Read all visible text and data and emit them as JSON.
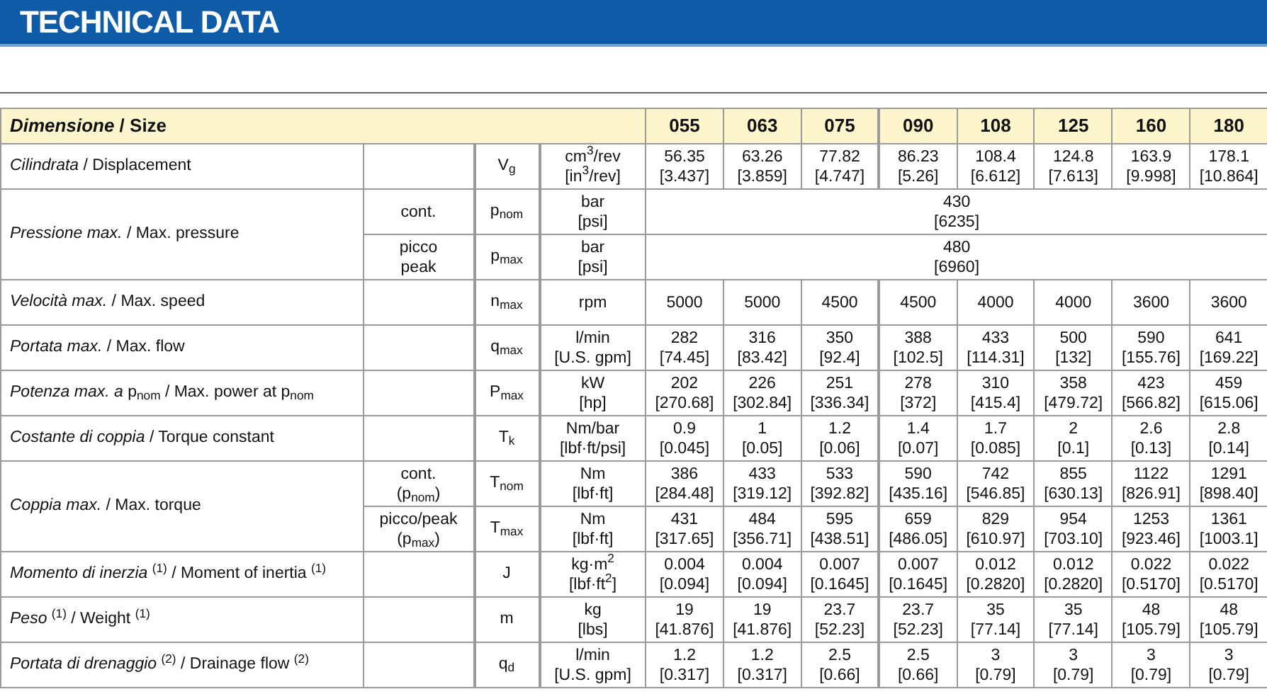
{
  "title": "TECHNICAL DATA",
  "table": {
    "header_label": "*Dimensione* / Size",
    "sizes": [
      "055",
      "063",
      "075",
      "090",
      "108",
      "125",
      "160",
      "180"
    ],
    "rows": [
      {
        "label": "*Cilindrata* / Displacement",
        "subrows": [
          {
            "symbol": "V$_{g}$",
            "unit": [
              "cm$^{3}$/rev",
              "[in$^{3}$/rev]"
            ],
            "values": [
              [
                "56.35",
                "[3.437]"
              ],
              [
                "63.26",
                "[3.859]"
              ],
              [
                "77.82",
                "[4.747]"
              ],
              [
                "86.23",
                "[5.26]"
              ],
              [
                "108.4",
                "[6.612]"
              ],
              [
                "124.8",
                "[7.613]"
              ],
              [
                "163.9",
                "[9.998]"
              ],
              [
                "178.1",
                "[10.864]"
              ]
            ]
          }
        ]
      },
      {
        "label": "*Pressione max.* / Max. pressure",
        "subrows": [
          {
            "condition": [
              "cont."
            ],
            "symbol": "p$_{nom}$",
            "unit": [
              "bar",
              "[psi]"
            ],
            "merged_value": [
              "430",
              "[6235]"
            ]
          },
          {
            "condition": [
              "picco",
              "peak"
            ],
            "symbol": "p$_{max}$",
            "unit": [
              "bar",
              "[psi]"
            ],
            "merged_value": [
              "480",
              "[6960]"
            ]
          }
        ]
      },
      {
        "label": "*Velocità max.* / Max. speed",
        "subrows": [
          {
            "symbol": "n$_{max}$",
            "unit": [
              "rpm"
            ],
            "values": [
              [
                "5000"
              ],
              [
                "5000"
              ],
              [
                "4500"
              ],
              [
                "4500"
              ],
              [
                "4000"
              ],
              [
                "4000"
              ],
              [
                "3600"
              ],
              [
                "3600"
              ]
            ]
          }
        ]
      },
      {
        "label": "*Portata max.* / Max. flow",
        "subrows": [
          {
            "symbol": "q$_{max}$",
            "unit": [
              "l/min",
              "[U.S. gpm]"
            ],
            "values": [
              [
                "282",
                "[74.45]"
              ],
              [
                "316",
                "[83.42]"
              ],
              [
                "350",
                "[92.4]"
              ],
              [
                "388",
                "[102.5]"
              ],
              [
                "433",
                "[114.31]"
              ],
              [
                "500",
                "[132]"
              ],
              [
                "590",
                "[155.76]"
              ],
              [
                "641",
                "[169.22]"
              ]
            ]
          }
        ]
      },
      {
        "label": "*Potenza max. a* p$_{nom}$ / Max. power at p$_{nom}$",
        "subrows": [
          {
            "symbol": "P$_{max}$",
            "unit": [
              "kW",
              "[hp]"
            ],
            "values": [
              [
                "202",
                "[270.68]"
              ],
              [
                "226",
                "[302.84]"
              ],
              [
                "251",
                "[336.34]"
              ],
              [
                "278",
                "[372]"
              ],
              [
                "310",
                "[415.4]"
              ],
              [
                "358",
                "[479.72]"
              ],
              [
                "423",
                "[566.82]"
              ],
              [
                "459",
                "[615.06]"
              ]
            ]
          }
        ]
      },
      {
        "label": "*Costante di coppia* / Torque constant",
        "subrows": [
          {
            "symbol": "T$_{k}$",
            "unit": [
              "Nm/bar",
              "[lbf·ft/psi]"
            ],
            "values": [
              [
                "0.9",
                "[0.045]"
              ],
              [
                "1",
                "[0.05]"
              ],
              [
                "1.2",
                "[0.06]"
              ],
              [
                "1.4",
                "[0.07]"
              ],
              [
                "1.7",
                "[0.085]"
              ],
              [
                "2",
                "[0.1]"
              ],
              [
                "2.6",
                "[0.13]"
              ],
              [
                "2.8",
                "[0.14]"
              ]
            ]
          }
        ]
      },
      {
        "label": "*Coppia max.* / Max. torque",
        "subrows": [
          {
            "condition": [
              "cont.",
              "(p$_{nom}$)"
            ],
            "symbol": "T$_{nom}$",
            "unit": [
              "Nm",
              "[lbf·ft]"
            ],
            "values": [
              [
                "386",
                "[284.48]"
              ],
              [
                "433",
                "[319.12]"
              ],
              [
                "533",
                "[392.82]"
              ],
              [
                "590",
                "[435.16]"
              ],
              [
                "742",
                "[546.85]"
              ],
              [
                "855",
                "[630.13]"
              ],
              [
                "1122",
                "[826.91]"
              ],
              [
                "1291",
                "[898.40]"
              ]
            ]
          },
          {
            "condition": [
              "picco/peak",
              "(p$_{max}$)"
            ],
            "symbol": "T$_{max}$",
            "unit": [
              "Nm",
              "[lbf·ft]"
            ],
            "values": [
              [
                "431",
                "[317.65]"
              ],
              [
                "484",
                "[356.71]"
              ],
              [
                "595",
                "[438.51]"
              ],
              [
                "659",
                "[486.05]"
              ],
              [
                "829",
                "[610.97]"
              ],
              [
                "954",
                "[703.10]"
              ],
              [
                "1253",
                "[923.46]"
              ],
              [
                "1361",
                "[1003.1]"
              ]
            ]
          }
        ]
      },
      {
        "label": "*Momento di inerzia* $^{(1)}$ / Moment of inertia $^{(1)}$",
        "subrows": [
          {
            "symbol": "J",
            "unit": [
              "kg·m$^{2}$",
              "[lbf·ft$^{2}$]"
            ],
            "values": [
              [
                "0.004",
                "[0.094]"
              ],
              [
                "0.004",
                "[0.094]"
              ],
              [
                "0.007",
                "[0.1645]"
              ],
              [
                "0.007",
                "[0.1645]"
              ],
              [
                "0.012",
                "[0.2820]"
              ],
              [
                "0.012",
                "[0.2820]"
              ],
              [
                "0.022",
                "[0.5170]"
              ],
              [
                "0.022",
                "[0.5170]"
              ]
            ]
          }
        ]
      },
      {
        "label": "*Peso* $^{(1)}$ / Weight $^{(1)}$",
        "subrows": [
          {
            "symbol": "m",
            "unit": [
              "kg",
              "[lbs]"
            ],
            "values": [
              [
                "19",
                "[41.876]"
              ],
              [
                "19",
                "[41.876]"
              ],
              [
                "23.7",
                "[52.23]"
              ],
              [
                "23.7",
                "[52.23]"
              ],
              [
                "35",
                "[77.14]"
              ],
              [
                "35",
                "[77.14]"
              ],
              [
                "48",
                "[105.79]"
              ],
              [
                "48",
                "[105.79]"
              ]
            ]
          }
        ]
      },
      {
        "label": "*Portata di drenaggio* $^{(2)}$ / Drainage flow $^{(2)}$",
        "subrows": [
          {
            "symbol": "q$_{d}$",
            "unit": [
              "l/min",
              "[U.S. gpm]"
            ],
            "values": [
              [
                "1.2",
                "[0.317]"
              ],
              [
                "1.2",
                "[0.317]"
              ],
              [
                "2.5",
                "[0.66]"
              ],
              [
                "2.5",
                "[0.66]"
              ],
              [
                "3",
                "[0.79]"
              ],
              [
                "3",
                "[0.79]"
              ],
              [
                "3",
                "[0.79]"
              ],
              [
                "3",
                "[0.79]"
              ]
            ]
          }
        ]
      }
    ]
  }
}
